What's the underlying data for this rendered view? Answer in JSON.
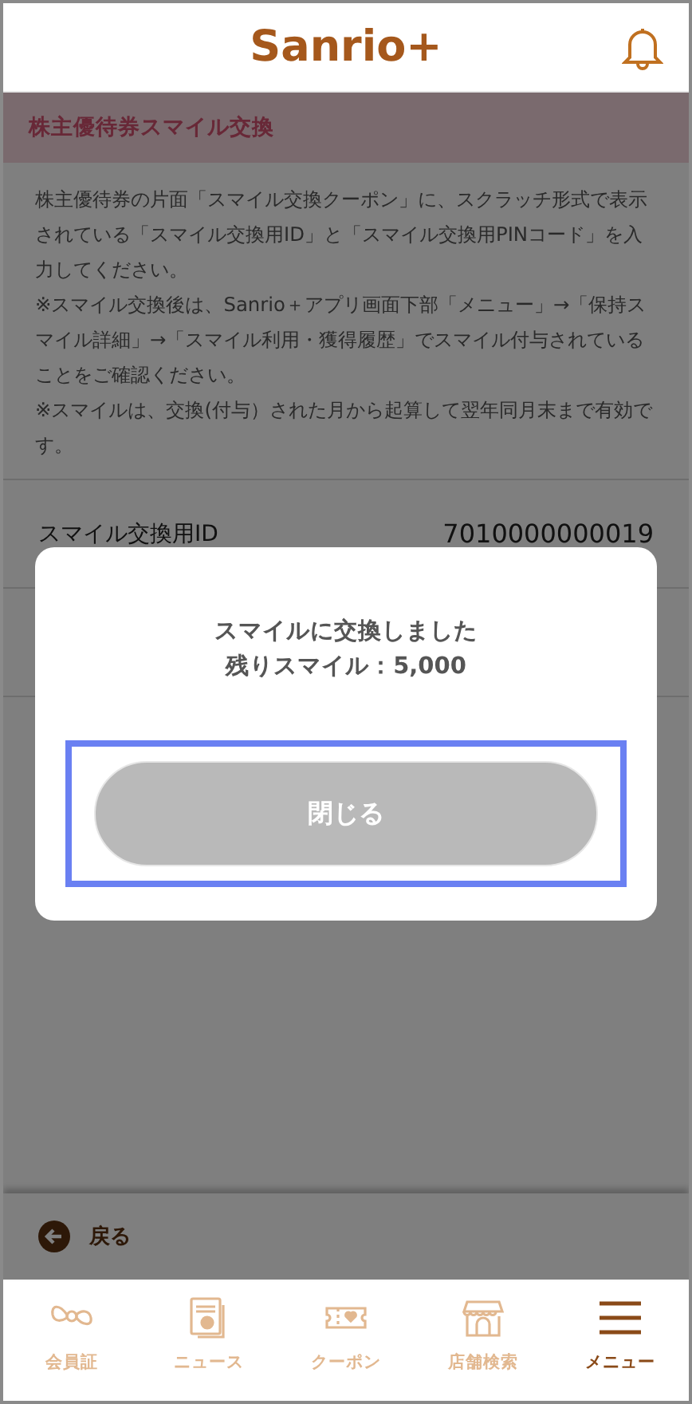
{
  "header": {
    "logo": "Sanrio+"
  },
  "section_title": "株主優待券スマイル交換",
  "description": [
    "株主優待券の片面「スマイル交換クーポン」に、スクラッチ形式で表示されている「スマイル交換用ID」と「スマイル交換用PINコード」を入力してください。",
    "※スマイル交換後は、Sanrio＋アプリ画面下部「メニュー」→「保持スマイル詳細」→「スマイル利用・獲得履歴」でスマイル付与されていることをご確認ください。",
    "※スマイルは、交換(付与）された月から起算して翌年同月末まで有効です。"
  ],
  "fields": [
    {
      "label": "スマイル交換用ID",
      "value": "7010000000019"
    }
  ],
  "dialog": {
    "lines": [
      "スマイルに交換しました",
      "残りスマイル：5,000"
    ],
    "button": "閉じる"
  },
  "back_link": "戻る",
  "nav": [
    {
      "label": "会員証",
      "selected": false
    },
    {
      "label": "ニュース",
      "selected": false
    },
    {
      "label": "クーポン",
      "selected": false
    },
    {
      "label": "店舗検索",
      "selected": false
    },
    {
      "label": "メニュー",
      "selected": true
    }
  ]
}
